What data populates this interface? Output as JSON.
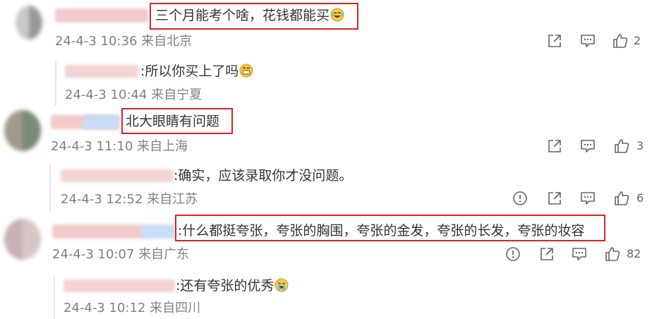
{
  "comments": [
    {
      "text": "三个月能考个啥，花钱都能买",
      "meta": "24-4-3 10:36 来自北京",
      "likes": "2",
      "replies": [
        {
          "text": ":所以你买上了吗",
          "meta": "24-4-3 10:44 来自宁夏"
        }
      ]
    },
    {
      "text": "北大眼睛有问题",
      "meta": "24-4-3 11:10 来自上海",
      "likes": "3",
      "replies": [
        {
          "text": ":确实，应该录取你才没问题。",
          "meta": "24-4-3 12:52 来自江苏",
          "likes": "6"
        }
      ]
    },
    {
      "text": ":什么都挺夸张，夸张的胸围，夸张的金发，夸张的长发，夸张的妆容",
      "meta": "24-4-3 10:07 来自广东",
      "likes": "82",
      "replies": [
        {
          "text": ":还有夸张的优秀",
          "meta": "24-4-3 10:12 来自四川"
        }
      ]
    }
  ],
  "colors": {
    "highlight_border": "#d9232a",
    "meta_text": "#808080",
    "icon": "#666666"
  },
  "icons": [
    "share-icon",
    "comment-icon",
    "like-icon",
    "report-icon",
    "laugh-cry-emoji",
    "grin-emoji",
    "crying-emoji"
  ]
}
